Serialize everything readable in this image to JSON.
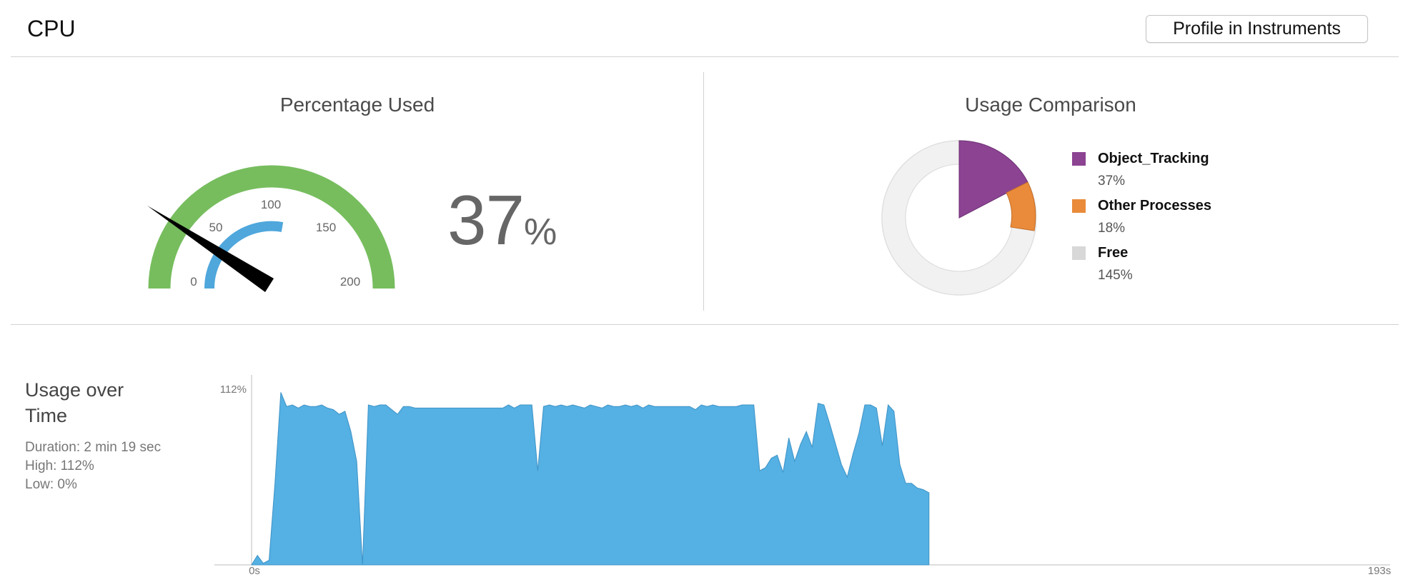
{
  "header": {
    "title": "CPU",
    "profile_button": "Profile in Instruments"
  },
  "gauge": {
    "title": "Percentage Used",
    "value": 37,
    "value_unit": "%",
    "inner_ticks": [
      "0",
      "50",
      "100",
      "150"
    ],
    "outer_tick": "200",
    "max": 200,
    "colors": {
      "outer": "#77bd5e",
      "inner": "#4fa7dc",
      "needle": "#000000"
    }
  },
  "comparison": {
    "title": "Usage Comparison",
    "legend": [
      {
        "name": "Object_Tracking",
        "value": "37%",
        "color": "#8b4392"
      },
      {
        "name": "Other Processes",
        "value": "18%",
        "color": "#e98b3a"
      },
      {
        "name": "Free",
        "value": "145%",
        "color": "#d8d8d8"
      }
    ]
  },
  "usage_over_time": {
    "title": "Usage over Time",
    "duration": "Duration: 2 min 19 sec",
    "high": "High: 112%",
    "low": "Low: 0%"
  },
  "chart_data": {
    "type": "area",
    "ylabel_top": "112%",
    "x_start_label": "0s",
    "x_end_label": "193s",
    "xlim": [
      0,
      193
    ],
    "ylim": [
      0,
      112
    ],
    "color": "#55b0e3",
    "x": [
      0,
      1,
      2,
      3,
      4,
      5,
      6,
      7,
      8,
      9,
      10,
      11,
      12,
      13,
      14,
      15,
      16,
      17,
      18,
      19,
      20,
      21,
      22,
      23,
      24,
      25,
      26,
      27,
      28,
      29,
      30,
      31,
      32,
      33,
      34,
      35,
      36,
      37,
      38,
      39,
      40,
      41,
      42,
      43,
      44,
      45,
      46,
      47,
      48,
      49,
      50,
      51,
      52,
      53,
      54,
      55,
      56,
      57,
      58,
      59,
      60,
      61,
      62,
      63,
      64,
      65,
      66,
      67,
      68,
      69,
      70,
      71,
      72,
      73,
      74,
      75,
      76,
      77,
      78,
      79,
      80,
      81,
      82,
      83,
      84,
      85,
      86,
      87,
      88,
      89,
      90,
      91,
      92,
      93,
      94,
      95,
      96,
      97,
      98,
      99,
      100,
      101,
      102,
      103,
      104,
      105,
      106,
      107,
      108,
      109,
      110,
      111,
      112,
      113,
      114,
      115,
      116
    ],
    "values": [
      0,
      6,
      1,
      3,
      52,
      110,
      101,
      102,
      100,
      102,
      101,
      101,
      102,
      100,
      99,
      96,
      98,
      85,
      66,
      0,
      102,
      101,
      102,
      102,
      99,
      96,
      101,
      101,
      100,
      100,
      100,
      100,
      100,
      100,
      100,
      100,
      100,
      100,
      100,
      100,
      100,
      100,
      100,
      100,
      102,
      100,
      102,
      102,
      102,
      60,
      101,
      102,
      101,
      102,
      101,
      102,
      101,
      100,
      102,
      101,
      100,
      102,
      101,
      101,
      102,
      101,
      102,
      100,
      102,
      101,
      101,
      101,
      101,
      101,
      101,
      101,
      99,
      102,
      101,
      102,
      101,
      101,
      101,
      101,
      102,
      102,
      102,
      60,
      62,
      68,
      70,
      59,
      81,
      66,
      77,
      85,
      75,
      103,
      102,
      90,
      77,
      64,
      56,
      71,
      84,
      102,
      102,
      100,
      76,
      102,
      98,
      64,
      52,
      52,
      49,
      48,
      46
    ]
  }
}
